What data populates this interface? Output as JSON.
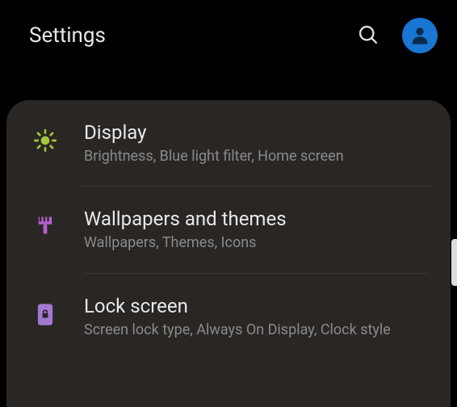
{
  "header": {
    "title": "Settings"
  },
  "items": [
    {
      "title": "Display",
      "subtitle": "Brightness, Blue light filter, Home screen"
    },
    {
      "title": "Wallpapers and themes",
      "subtitle": "Wallpapers, Themes, Icons"
    },
    {
      "title": "Lock screen",
      "subtitle": "Screen lock type, Always On Display, Clock style"
    }
  ]
}
